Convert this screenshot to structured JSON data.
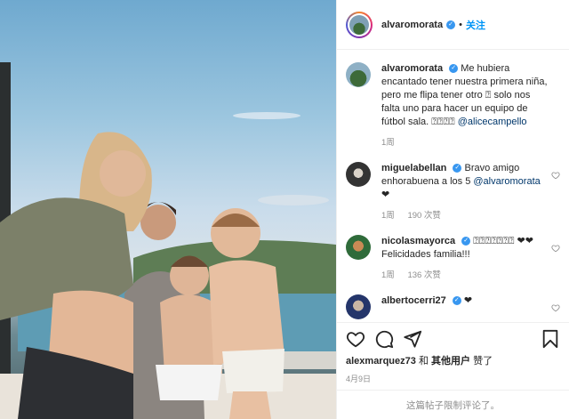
{
  "post": {
    "author": "alvaromorata",
    "verified_mark": "✓",
    "separator": "•",
    "follow_label": "关注"
  },
  "caption": {
    "username": "alvaromorata",
    "text": "Me hubiera encantado tener nuestra primera niña, pero me flipa tener otro ⍰ solo nos falta uno para hacer un equipo de fútbol sala. ⍰⍰⍰⍰",
    "mention": "@alicecampello",
    "time": "1周"
  },
  "comments": [
    {
      "username": "miguelabellan",
      "text": "Bravo amigo enhorabuena a los 5",
      "mention": "@alvaromorata",
      "suffix": "❤",
      "time": "1周",
      "likes": "190 次赞"
    },
    {
      "username": "nicolasmayorca",
      "text": "⍰⍰⍰⍰⍰⍰⍰ ❤❤ Felicidades familia!!!",
      "mention": "",
      "suffix": "",
      "time": "1周",
      "likes": "136 次赞"
    },
    {
      "username": "albertocerri27",
      "text": "❤",
      "mention": "",
      "suffix": "",
      "time": "",
      "likes": ""
    }
  ],
  "likes_line": {
    "user": "alexmarquez73",
    "and_text": "和",
    "others": "其他用户",
    "liked": "赞了"
  },
  "date": "4月9日",
  "limited_text": "这篇帖子限制评论了。",
  "icons": [
    "heart-icon",
    "comment-icon",
    "share-icon",
    "bookmark-icon"
  ],
  "colors": {
    "accent": "#0095f6",
    "verified": "#3897f0",
    "muted": "#8e8e8e"
  }
}
